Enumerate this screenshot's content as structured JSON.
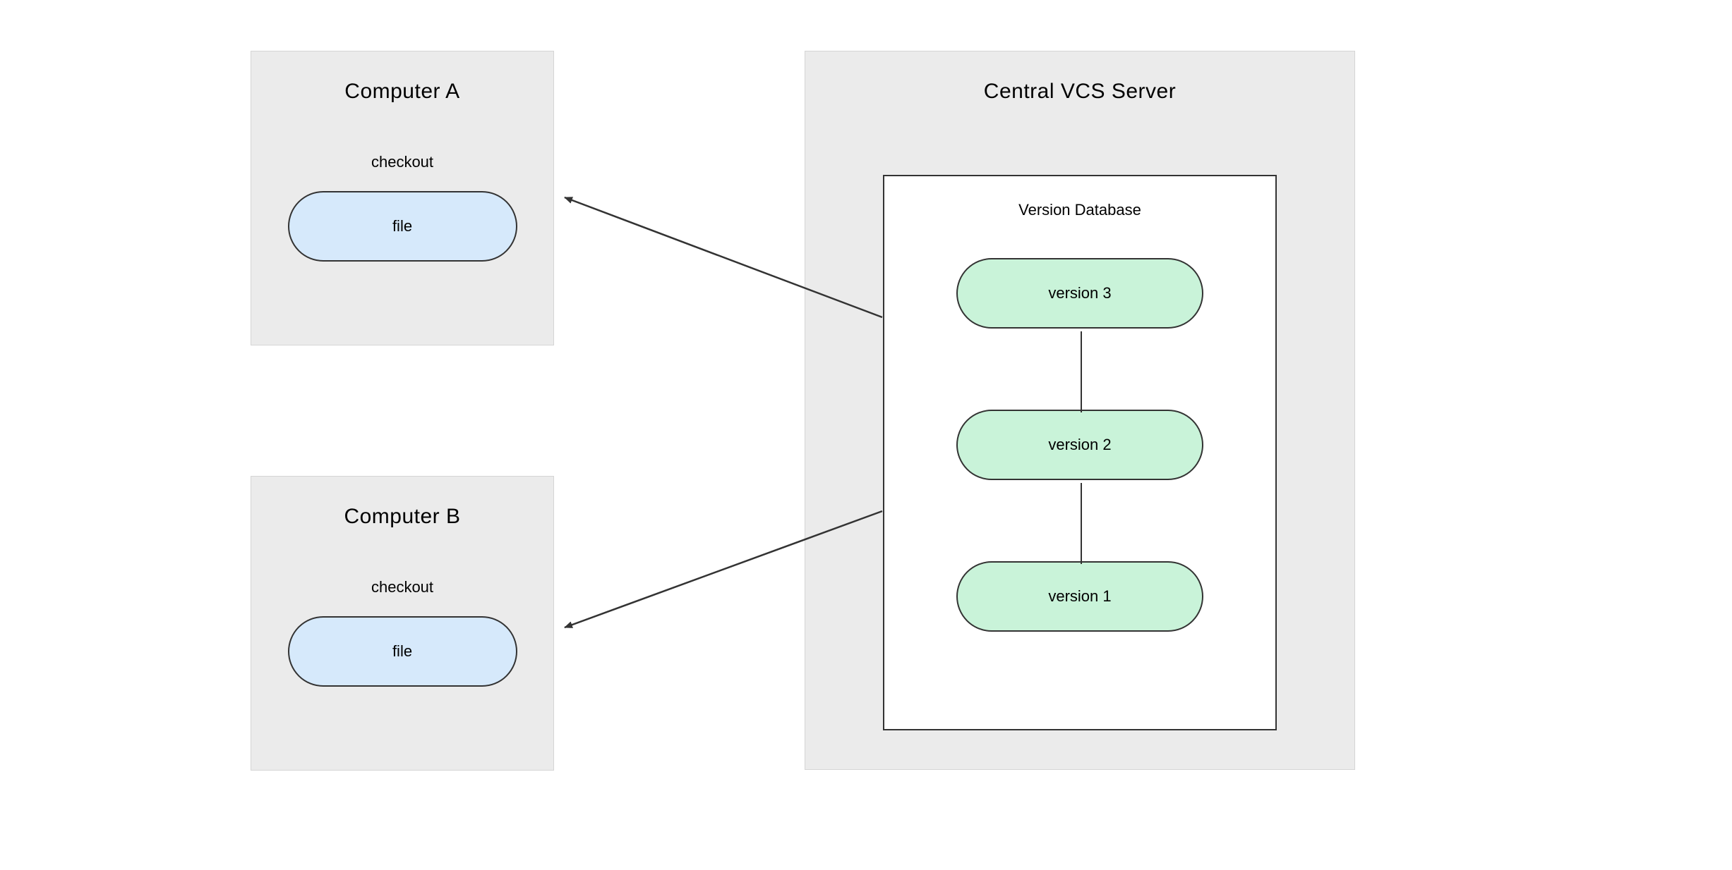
{
  "computerA": {
    "title": "Computer A",
    "checkoutLabel": "checkout",
    "fileLabel": "file"
  },
  "computerB": {
    "title": "Computer B",
    "checkoutLabel": "checkout",
    "fileLabel": "file"
  },
  "server": {
    "title": "Central VCS Server",
    "databaseTitle": "Version Database",
    "versions": {
      "v3": "version 3",
      "v2": "version 2",
      "v1": "version 1"
    }
  },
  "colors": {
    "panelBg": "#ebebeb",
    "pillBlue": "#d6e9fb",
    "pillGreen": "#c9f3d9",
    "stroke": "#333333"
  }
}
